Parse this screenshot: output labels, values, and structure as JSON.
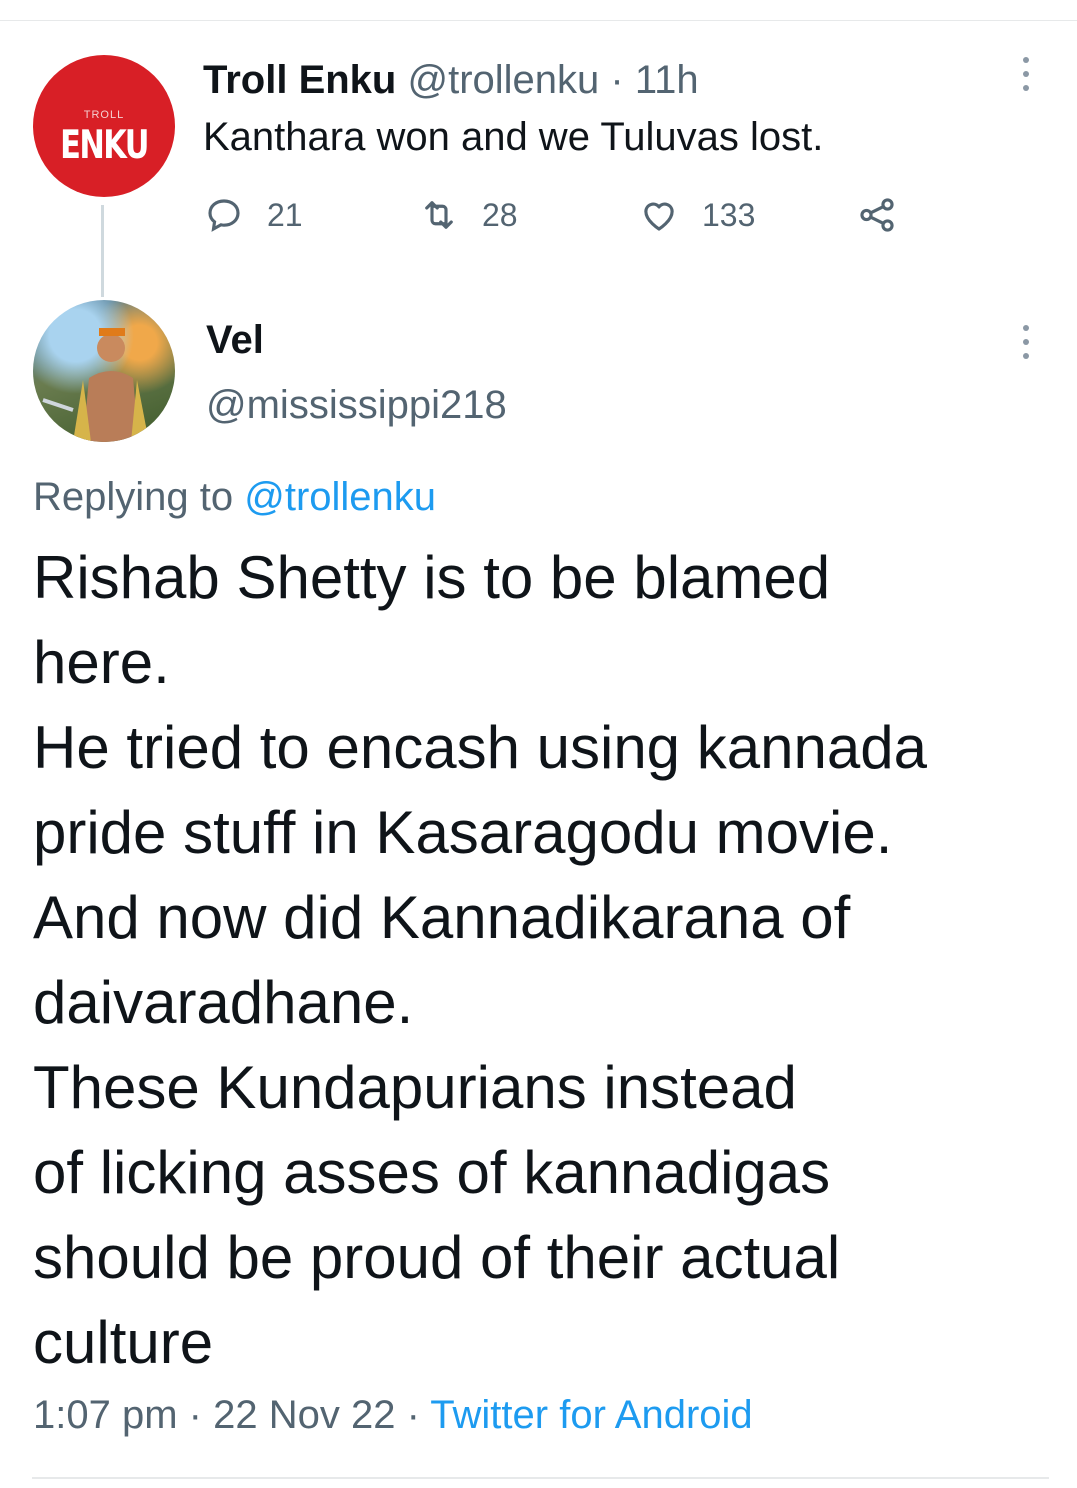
{
  "colors": {
    "link": "#1d9bf0",
    "muted": "#536471",
    "avatar_red": "#d81f26"
  },
  "parent_tweet": {
    "avatar_text_top": "TROLL",
    "avatar_text": "ENKU",
    "display_name": "Troll Enku",
    "handle": "@trollenku",
    "separator": "·",
    "time": "11h",
    "text": "Kanthara won and we Tuluvas lost.",
    "actions": {
      "reply": {
        "icon": "reply-icon",
        "count": "21"
      },
      "retweet": {
        "icon": "retweet-icon",
        "count": "28"
      },
      "like": {
        "icon": "like-icon",
        "count": "133"
      },
      "share": {
        "icon": "share-icon"
      }
    },
    "more_icon": "more-vertical-icon"
  },
  "reply_tweet": {
    "display_name": "Vel",
    "handle": "@mississippi218",
    "replying_prefix": "Replying to",
    "replying_handle": "@trollenku",
    "body_lines": [
      "Rishab Shetty is to be blamed",
      "here.",
      "He tried to encash using kannada",
      "pride stuff in Kasaragodu movie.",
      "And now did Kannadikarana of",
      "daivaradhane.",
      "These Kundapurians instead",
      "of licking asses of kannadigas",
      "should be proud of their actual",
      "culture"
    ],
    "time": "1:07 pm",
    "separator1": "·",
    "date": "22 Nov 22",
    "separator2": "·",
    "source": "Twitter for Android",
    "more_icon": "more-vertical-icon"
  }
}
